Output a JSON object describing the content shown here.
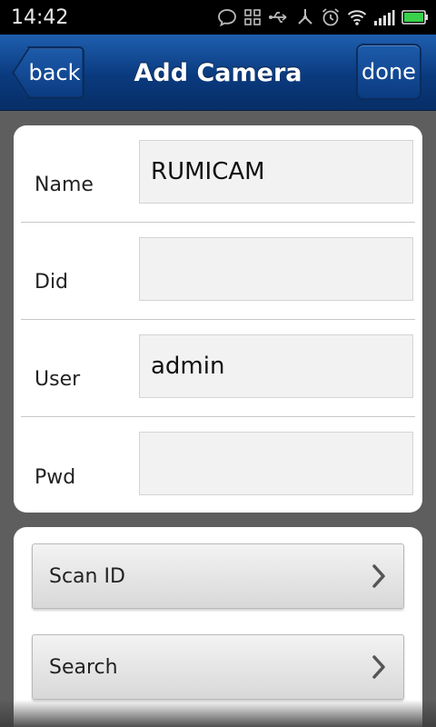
{
  "status_bar": {
    "time": "14:42",
    "icons": [
      "chat-icon",
      "grid-icon",
      "usb-icon",
      "network-icon",
      "alarm-icon",
      "wifi-icon",
      "signal-icon",
      "battery-icon"
    ]
  },
  "nav": {
    "title": "Add Camera",
    "back_label": "back",
    "done_label": "done"
  },
  "form": {
    "fields": [
      {
        "label": "Name",
        "value": "RUMICAM",
        "placeholder": ""
      },
      {
        "label": "Did",
        "value": "",
        "placeholder": ""
      },
      {
        "label": "User",
        "value": "admin",
        "placeholder": ""
      },
      {
        "label": "Pwd",
        "value": "",
        "placeholder": ""
      }
    ]
  },
  "actions": [
    {
      "label": "Scan ID",
      "icon": "chevron-right-icon"
    },
    {
      "label": "Search",
      "icon": "chevron-right-icon"
    }
  ],
  "colors": {
    "nav_top": "#1f5fb0",
    "nav_bottom": "#072e66",
    "battery": "#39d14b",
    "background": "#5e5e5e"
  }
}
